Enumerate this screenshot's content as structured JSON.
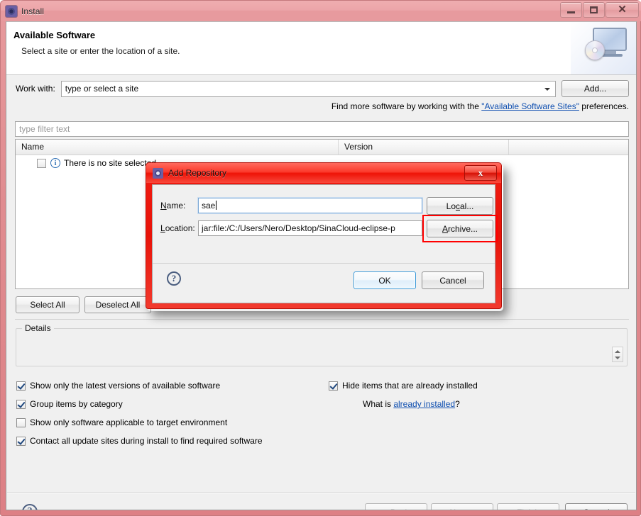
{
  "window": {
    "title": "Install",
    "icon": "eclipse-gear-icon",
    "buttons": {
      "minimize": "minimize-icon",
      "maximize": "maximize-icon",
      "close": "close-icon"
    }
  },
  "wizard": {
    "title": "Available Software",
    "description": "Select a site or enter the location of a site.",
    "banner_icon": "monitor-with-cd-icon"
  },
  "work_with": {
    "label": "Work with:",
    "value": "type or select a site",
    "placeholder": "type or select a site",
    "add_button": "Add...",
    "dropdown_icon": "chevron-down-icon"
  },
  "hint": {
    "prefix": "Find more software by working with the ",
    "link": "\"Available Software Sites\"",
    "suffix": " preferences."
  },
  "filter": {
    "placeholder": "type filter text",
    "value": "type filter text"
  },
  "table": {
    "columns": [
      "Name",
      "Version",
      ""
    ],
    "rows": [
      {
        "checked": false,
        "icon": "info-icon",
        "icon_glyph": "i",
        "name": "There is no site selected",
        "version": ""
      }
    ]
  },
  "selection_buttons": {
    "select_all": "Select All",
    "deselect_all": "Deselect All"
  },
  "details": {
    "legend": "Details",
    "content": "",
    "spinner_icon": "spinner-up-down-icon"
  },
  "options": [
    {
      "label": "Show only the latest versions of available software",
      "checked": true
    },
    {
      "label": "Group items by category",
      "checked": true
    },
    {
      "label": "Show only software applicable to target environment",
      "checked": false
    },
    {
      "label": "Contact all update sites during install to find required software",
      "checked": true
    },
    {
      "label": "Hide items that are already installed",
      "checked": true
    }
  ],
  "what_is": {
    "prefix": "What is ",
    "link": "already installed",
    "suffix": "?"
  },
  "footer": {
    "help_icon": "help-question-icon",
    "help_glyph": "?",
    "back": "< Back",
    "next": "Next >",
    "finish": "Finish",
    "cancel": "Cancel",
    "back_enabled": false,
    "next_enabled": false,
    "finish_enabled": false,
    "cancel_enabled": true
  },
  "modal": {
    "title": "Add Repository",
    "icon": "eclipse-gear-icon",
    "close_glyph": "x",
    "name_label_mnemonic": "N",
    "name_label_rest": "ame:",
    "name_value": "sae",
    "location_label_mnemonic": "L",
    "location_label_rest": "ocation:",
    "location_value": "jar:file:/C:/Users/Nero/Desktop/SinaCloud-eclipse-p",
    "local_button_pre": "Lo",
    "local_button_mnemonic": "c",
    "local_button_post": "al...",
    "archive_button_mnemonic": "A",
    "archive_button_rest": "rchive...",
    "help_glyph": "?",
    "ok": "OK",
    "cancel": "Cancel",
    "highlight_color": "#ff0000",
    "frame_color": "#ee1307"
  }
}
